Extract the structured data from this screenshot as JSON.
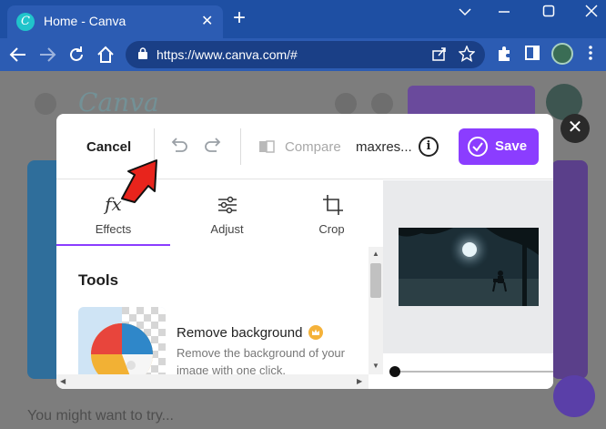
{
  "browser": {
    "tab_title": "Home - Canva",
    "tab_favicon": "C",
    "url": "https://www.canva.com/#",
    "new_tab": "+",
    "close_tab": "✕"
  },
  "background": {
    "section_title": "You might want to try..."
  },
  "modal": {
    "cancel_label": "Cancel",
    "compare_label": "Compare",
    "filename": "maxres...",
    "info_glyph": "i",
    "save_label": "Save",
    "close_glyph": "✕",
    "tabs": [
      {
        "label": "Effects",
        "icon": "fx",
        "icon_name": "effects-icon"
      },
      {
        "label": "Adjust",
        "icon": "adjust-sliders-icon"
      },
      {
        "label": "Crop",
        "icon": "crop-icon"
      }
    ],
    "active_tab": "Effects",
    "tools_title": "Tools",
    "tool": {
      "title": "Remove background",
      "description": "Remove the background of your image with one click."
    }
  },
  "colors": {
    "accent": "#8b3dff",
    "chrome_blue": "#2c5cb3",
    "arrow_red": "#e8241c"
  }
}
